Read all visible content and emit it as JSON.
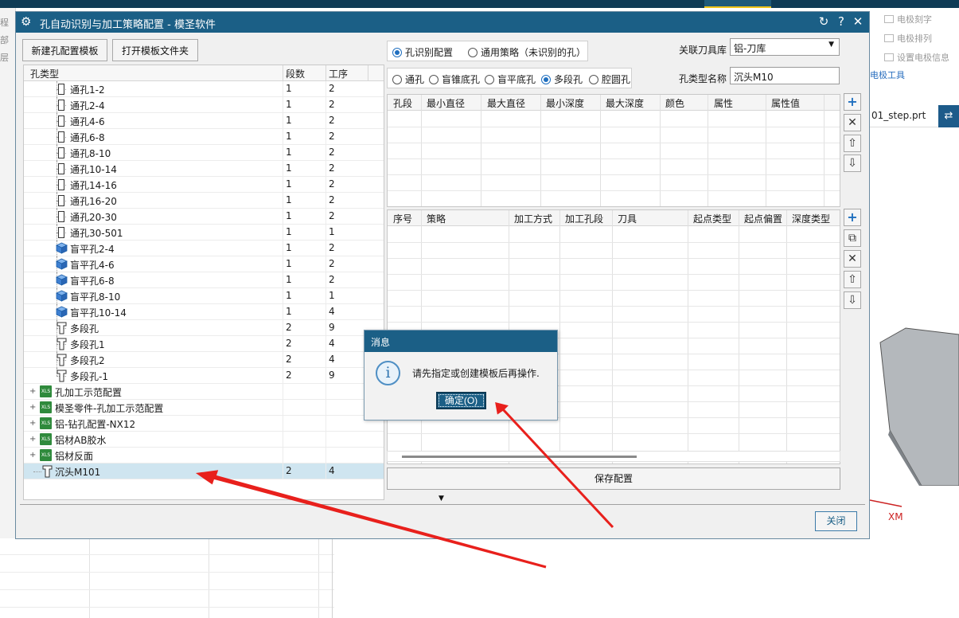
{
  "background_app": {
    "left_labels": [
      "程",
      "部",
      "层"
    ],
    "tools": [
      "电极刻字",
      "电极排列",
      "设置电极信息"
    ],
    "tool_tab": "电极工具",
    "file_tab": "01_step.prt",
    "axis_label": "XM"
  },
  "main_dialog": {
    "title": "孔自动识别与加工策略配置 - 模圣软件",
    "title_icon": "gear-icon",
    "title_buttons": {
      "refresh": "↻",
      "help": "?",
      "close": "✕"
    },
    "buttons": {
      "new_template": "新建孔配置模板",
      "open_folder": "打开模板文件夹",
      "save_config": "保存配置",
      "close": "关闭"
    },
    "tree": {
      "columns": [
        "孔类型",
        "段数",
        "工序"
      ],
      "rows": [
        {
          "name": "通孔1-2",
          "segs": "1",
          "procs": "2",
          "icon": "through-hole-icon",
          "indent": 2
        },
        {
          "name": "通孔2-4",
          "segs": "1",
          "procs": "2",
          "icon": "through-hole-icon",
          "indent": 2
        },
        {
          "name": "通孔4-6",
          "segs": "1",
          "procs": "2",
          "icon": "through-hole-icon",
          "indent": 2
        },
        {
          "name": "通孔6-8",
          "segs": "1",
          "procs": "2",
          "icon": "through-hole-icon",
          "indent": 2
        },
        {
          "name": "通孔8-10",
          "segs": "1",
          "procs": "2",
          "icon": "through-hole-icon",
          "indent": 2
        },
        {
          "name": "通孔10-14",
          "segs": "1",
          "procs": "2",
          "icon": "through-hole-icon",
          "indent": 2
        },
        {
          "name": "通孔14-16",
          "segs": "1",
          "procs": "2",
          "icon": "through-hole-icon",
          "indent": 2
        },
        {
          "name": "通孔16-20",
          "segs": "1",
          "procs": "2",
          "icon": "through-hole-icon",
          "indent": 2
        },
        {
          "name": "通孔20-30",
          "segs": "1",
          "procs": "2",
          "icon": "through-hole-icon",
          "indent": 2
        },
        {
          "name": "通孔30-501",
          "segs": "1",
          "procs": "1",
          "icon": "through-hole-icon",
          "indent": 2
        },
        {
          "name": "盲平孔2-4",
          "segs": "1",
          "procs": "2",
          "icon": "blind-hole-cube-icon",
          "indent": 2
        },
        {
          "name": "盲平孔4-6",
          "segs": "1",
          "procs": "2",
          "icon": "blind-hole-cube-icon",
          "indent": 2
        },
        {
          "name": "盲平孔6-8",
          "segs": "1",
          "procs": "2",
          "icon": "blind-hole-cube-icon",
          "indent": 2
        },
        {
          "name": "盲平孔8-10",
          "segs": "1",
          "procs": "1",
          "icon": "blind-hole-cube-icon",
          "indent": 2
        },
        {
          "name": "盲平孔10-14",
          "segs": "1",
          "procs": "4",
          "icon": "blind-hole-cube-icon",
          "indent": 2
        },
        {
          "name": "多段孔",
          "segs": "2",
          "procs": "9",
          "icon": "step-hole-icon",
          "indent": 2
        },
        {
          "name": "多段孔1",
          "segs": "2",
          "procs": "4",
          "icon": "step-hole-icon",
          "indent": 2
        },
        {
          "name": "多段孔2",
          "segs": "2",
          "procs": "4",
          "icon": "step-hole-icon",
          "indent": 2
        },
        {
          "name": "多段孔-1",
          "segs": "2",
          "procs": "9",
          "icon": "step-hole-icon",
          "indent": 2,
          "last": true
        },
        {
          "name": "孔加工示范配置",
          "segs": "",
          "procs": "",
          "icon": "xls-file-icon",
          "indent": 0,
          "expander": "+"
        },
        {
          "name": "模圣零件-孔加工示范配置",
          "segs": "",
          "procs": "",
          "icon": "xls-file-icon",
          "indent": 0,
          "expander": "+"
        },
        {
          "name": "铝-钻孔配置-NX12",
          "segs": "",
          "procs": "",
          "icon": "xls-file-icon",
          "indent": 0,
          "expander": "+"
        },
        {
          "name": "铝材AB胶水",
          "segs": "",
          "procs": "",
          "icon": "xls-file-icon",
          "indent": 0,
          "expander": "+"
        },
        {
          "name": "铝材反面",
          "segs": "",
          "procs": "",
          "icon": "xls-file-icon",
          "indent": 0,
          "expander": "+"
        },
        {
          "name": "沉头M101",
          "segs": "2",
          "procs": "4",
          "icon": "step-hole-icon",
          "indent": 1,
          "selected": true
        }
      ]
    },
    "mode_radios": [
      {
        "label": "孔识别配置",
        "checked": true
      },
      {
        "label": "通用策略（未识别的孔）",
        "checked": false
      }
    ],
    "type_radios": [
      {
        "label": "通孔",
        "checked": false
      },
      {
        "label": "盲锥底孔",
        "checked": false
      },
      {
        "label": "盲平底孔",
        "checked": false
      },
      {
        "label": "多段孔",
        "checked": true
      },
      {
        "label": "腔圆孔",
        "checked": false
      }
    ],
    "tool_library_label": "关联刀具库",
    "tool_library_value": "铝-刀库",
    "hole_type_name_label": "孔类型名称",
    "hole_type_name_value": "沉头M10",
    "segment_grid_columns": [
      "孔段",
      "最小直径",
      "最大直径",
      "最小深度",
      "最大深度",
      "颜色",
      "属性",
      "属性值"
    ],
    "strategy_grid_columns": [
      "序号",
      "策略",
      "加工方式",
      "加工孔段",
      "刀具",
      "起点类型",
      "起点偏置",
      "深度类型"
    ],
    "side_buttons": {
      "add": "+",
      "copy": "⧉",
      "delete": "✕",
      "up": "⇧",
      "down": "⇩"
    }
  },
  "message_dialog": {
    "title": "消息",
    "icon": "info-icon",
    "icon_glyph": "i",
    "text": "请先指定或创建模板后再操作.",
    "ok_label": "确定(O)"
  },
  "colors": {
    "titlebar": "#1b5f86",
    "selected_row": "#cfe5f0",
    "annotation_arrow": "#e8201c",
    "radio_accent": "#1f6fbf"
  }
}
